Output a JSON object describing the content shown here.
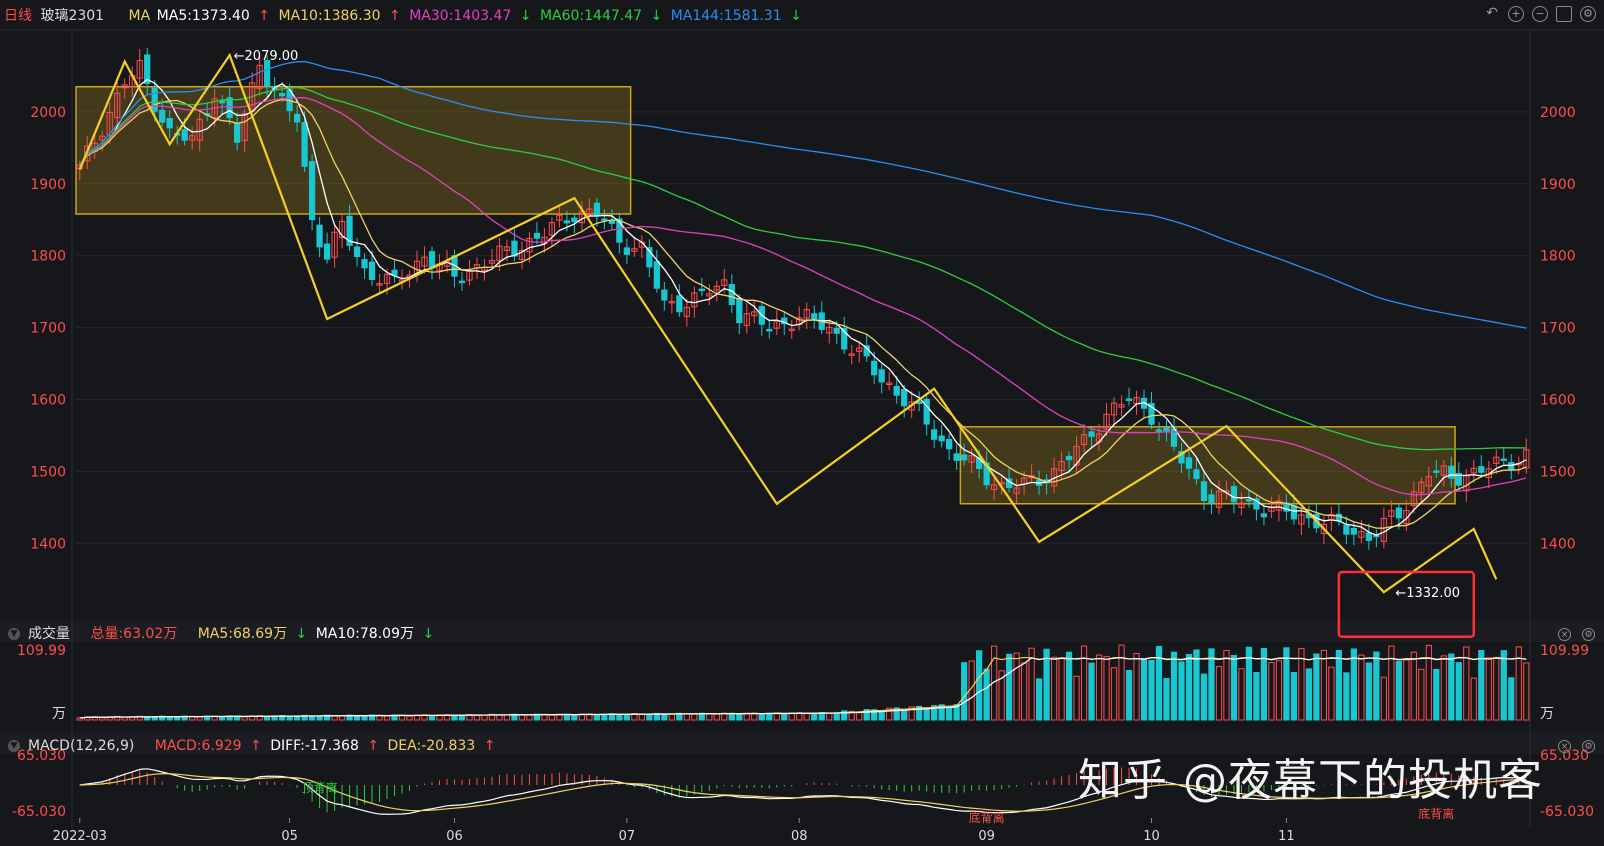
{
  "header": {
    "period": "日线",
    "symbol": "玻璃2301",
    "ma_label": "MA",
    "ma5": "MA5:1373.40",
    "ma10": "MA10:1386.30",
    "ma30": "MA30:1403.47",
    "ma60": "MA60:1447.47",
    "ma144": "MA144:1581.31",
    "arrow_up": "↑",
    "arrow_down": "↓"
  },
  "volume_header": {
    "title": "成交量",
    "total": "总量:63.02万",
    "ma5": "MA5:68.69万",
    "ma10": "MA10:78.09万",
    "unit": "万",
    "max_label": "109.99"
  },
  "macd_header": {
    "title": "MACD(12,26,9)",
    "macd": "MACD:6.929",
    "diff": "DIFF:-17.368",
    "dea": "DEA:-20.833",
    "top_label": "65.030",
    "bottom_label": "-65.030"
  },
  "annotations": {
    "high": "2079.00",
    "low": "1332.00",
    "div1": "顶背离",
    "div2": "底背离",
    "div3": "底背离"
  },
  "watermark": "知乎 @夜幕下的投机客",
  "colors": {
    "up": "#ff4d4d",
    "down": "#19c7d1",
    "ma5": "#ffffff",
    "ma10": "#f0d264",
    "ma30": "#e040c0",
    "ma60": "#2ecc40",
    "ma144": "#2a8ef0",
    "zigzag": "#f5d020",
    "box": "#c9a520",
    "axis_text": "#ff4d4d"
  },
  "chart_data": {
    "type": "candlestick",
    "y_ticks": [
      1400,
      1500,
      1600,
      1700,
      1800,
      1900,
      2000
    ],
    "ylim": [
      1310,
      2100
    ],
    "x_ticks": [
      "2022-03",
      "05",
      "06",
      "07",
      "08",
      "09",
      "10",
      "11"
    ],
    "bars": 194,
    "anchor_closes": [
      [
        0,
        1920
      ],
      [
        6,
        2040
      ],
      [
        8,
        2060
      ],
      [
        12,
        1970
      ],
      [
        15,
        1960
      ],
      [
        18,
        2030
      ],
      [
        21,
        1960
      ],
      [
        24,
        2070
      ],
      [
        27,
        2010
      ],
      [
        29,
        1990
      ],
      [
        31,
        1850
      ],
      [
        33,
        1800
      ],
      [
        35,
        1840
      ],
      [
        38,
        1780
      ],
      [
        42,
        1760
      ],
      [
        46,
        1800
      ],
      [
        50,
        1770
      ],
      [
        54,
        1790
      ],
      [
        58,
        1810
      ],
      [
        62,
        1830
      ],
      [
        66,
        1860
      ],
      [
        69,
        1860
      ],
      [
        72,
        1820
      ],
      [
        75,
        1810
      ],
      [
        78,
        1730
      ],
      [
        82,
        1740
      ],
      [
        86,
        1760
      ],
      [
        88,
        1720
      ],
      [
        92,
        1700
      ],
      [
        96,
        1715
      ],
      [
        100,
        1700
      ],
      [
        104,
        1660
      ],
      [
        108,
        1620
      ],
      [
        112,
        1580
      ],
      [
        116,
        1530
      ],
      [
        120,
        1500
      ],
      [
        123,
        1480
      ],
      [
        126,
        1480
      ],
      [
        130,
        1500
      ],
      [
        134,
        1540
      ],
      [
        137,
        1580
      ],
      [
        140,
        1600
      ],
      [
        143,
        1580
      ],
      [
        146,
        1530
      ],
      [
        150,
        1470
      ],
      [
        154,
        1460
      ],
      [
        158,
        1450
      ],
      [
        162,
        1440
      ],
      [
        166,
        1430
      ],
      [
        169,
        1420
      ],
      [
        172,
        1410
      ],
      [
        176,
        1440
      ],
      [
        180,
        1500
      ],
      [
        183,
        1490
      ],
      [
        186,
        1500
      ],
      [
        190,
        1510
      ],
      [
        194,
        1530
      ]
    ],
    "ma_lines": [
      "MA5",
      "MA10",
      "MA30",
      "MA60",
      "MA144"
    ],
    "volume_ylim": [
      0,
      110
    ],
    "macd_ylim": [
      -65.03,
      65.03
    ]
  }
}
